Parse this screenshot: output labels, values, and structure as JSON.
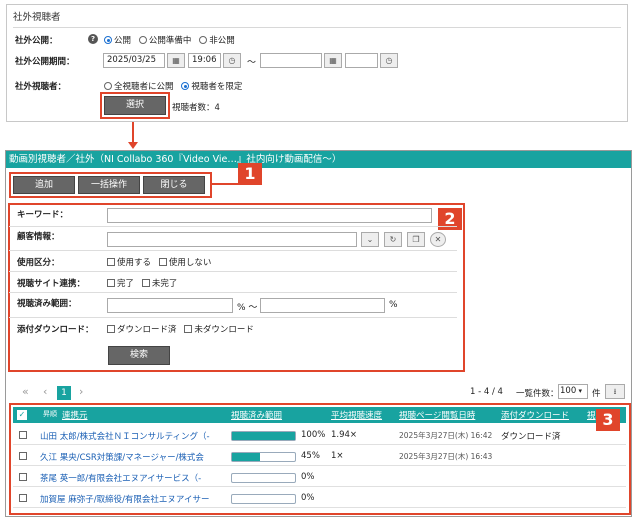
{
  "top_panel": {
    "title": "社外視聴者",
    "publish_label": "社外公開：",
    "publish_options": [
      "公開",
      "公開準備中",
      "非公開"
    ],
    "period_label": "社外公開期間：",
    "start_date": "2025/03/25",
    "start_time": "19:06",
    "tilde": "〜",
    "viewers_label": "社外視聴者：",
    "viewer_options": [
      "全視聴者に公開",
      "視聴者を限定"
    ],
    "select_button": "選択",
    "viewer_count": "視聴者数：4"
  },
  "window": {
    "title": "動画別視聴者／社外（NI Collabo 360『Video Vie…』社内向け動画配信〜）",
    "toolbar": [
      "追加",
      "一括操作",
      "閉じる"
    ],
    "callouts": [
      "1",
      "2",
      "3"
    ]
  },
  "filters": {
    "keyword_label": "キーワード：",
    "customer_label": "顧客情報：",
    "usage_label": "使用区分：",
    "usage_options": [
      "使用する",
      "使用しない"
    ],
    "site_label": "視聴サイト連携：",
    "site_options": [
      "完了",
      "未完了"
    ],
    "range_label": "視聴済み範囲：",
    "pct": "%",
    "pct_tilde": "% 〜",
    "download_label": "添付ダウンロード：",
    "download_options": [
      "ダウンロード済",
      "未ダウンロード"
    ],
    "search_button": "検索"
  },
  "pagination": {
    "first": "«",
    "prev": "‹",
    "current": "1",
    "next": "›",
    "range": "1 - 4 / 4",
    "per_page_label": "一覧件数：",
    "per_page": "100",
    "unit": "件"
  },
  "table": {
    "headers": [
      "連携元",
      "視聴済み範囲",
      "平均視聴速度",
      "視聴ページ閲覧日時",
      "添付ダウンロード",
      "視"
    ],
    "sort_icon": "昇順",
    "rows": [
      {
        "name": "山田 太郎/株式会社ＮＩコンサルティング（-",
        "progress": 100,
        "pct": "100%",
        "speed": "1.94×",
        "date": "2025年3月27日(木) 16:42",
        "download": "ダウンロード済"
      },
      {
        "name": "久江 果央/CSR対策課/マネージャー/株式会",
        "progress": 45,
        "pct": "45%",
        "speed": "1×",
        "date": "2025年3月27日(木) 16:43",
        "download": ""
      },
      {
        "name": "茶尾 英一郎/有限会社エヌアイサービス（-",
        "progress": 0,
        "pct": "0%",
        "speed": "",
        "date": "",
        "download": ""
      },
      {
        "name": "加賀屋 麻弥子/取締役/有限会社エヌアイサー",
        "progress": 0,
        "pct": "0%",
        "speed": "",
        "date": "",
        "download": ""
      }
    ]
  },
  "colors": {
    "accent": "#18a3a0",
    "callout": "#e0452b",
    "link": "#1a5fb4"
  }
}
